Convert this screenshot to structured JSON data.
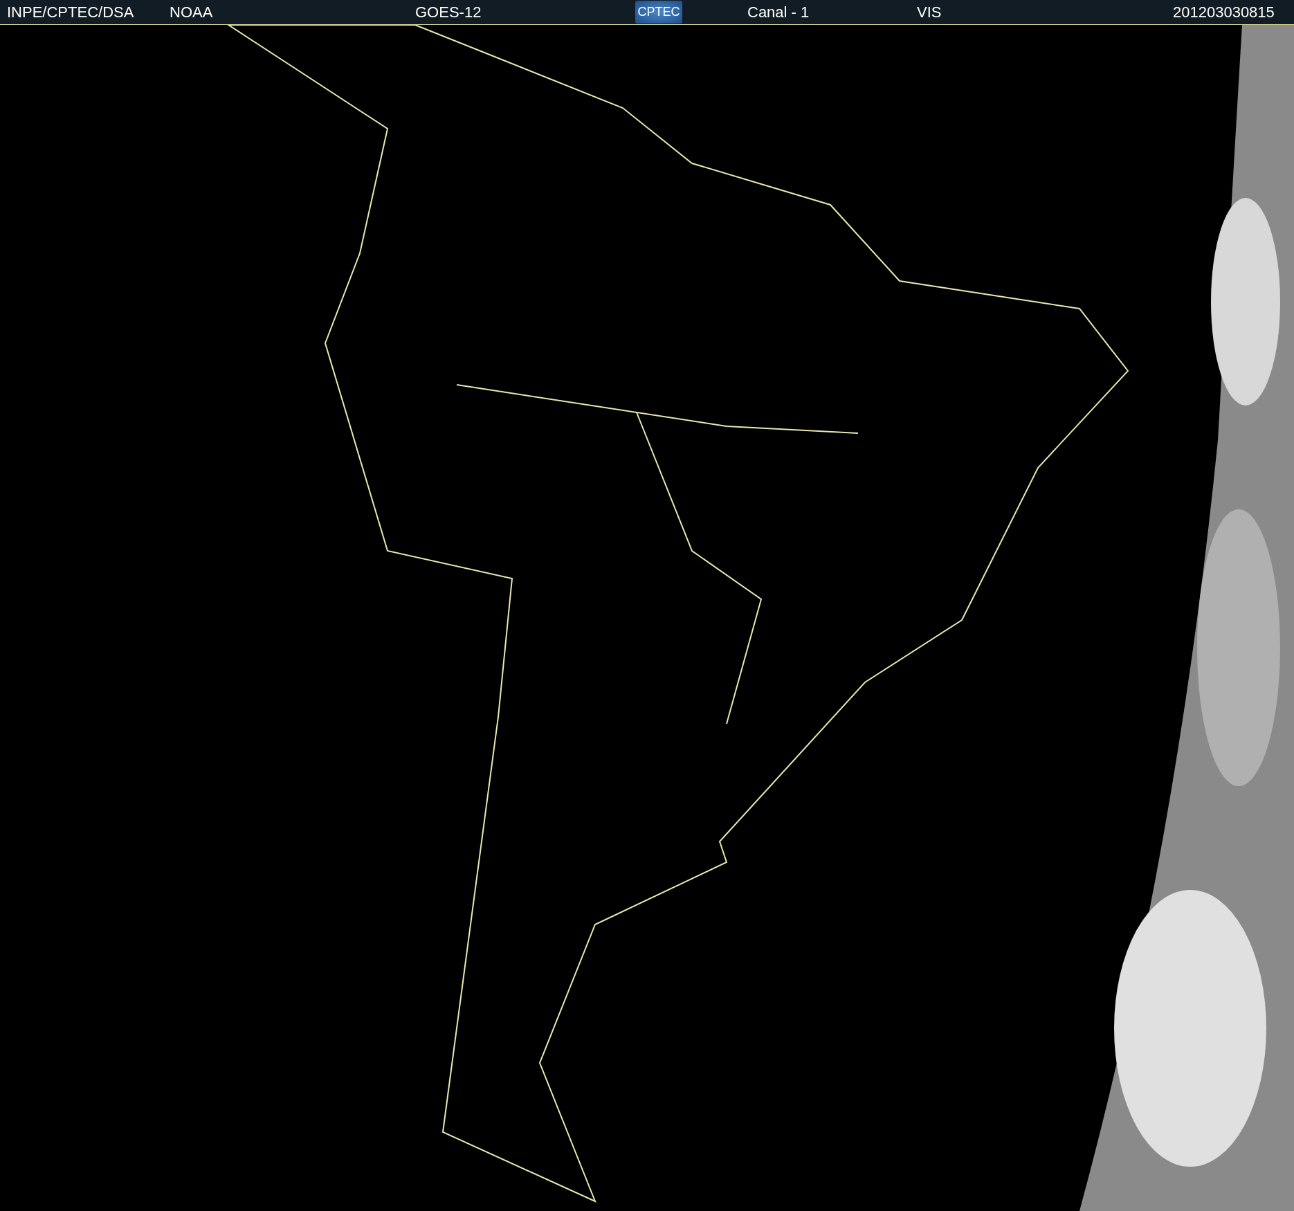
{
  "header": {
    "items": [
      {
        "kind": "text",
        "text": "INPE/CPTEC/DSA"
      },
      {
        "kind": "text",
        "text": "NOAA"
      },
      {
        "kind": "text",
        "text": "GOES-12"
      },
      {
        "kind": "logo",
        "text": "CPTEC"
      },
      {
        "kind": "text",
        "text": "Canal - 1"
      },
      {
        "kind": "text",
        "text": "VIS"
      },
      {
        "kind": "text",
        "text": "201203030815"
      }
    ]
  }
}
